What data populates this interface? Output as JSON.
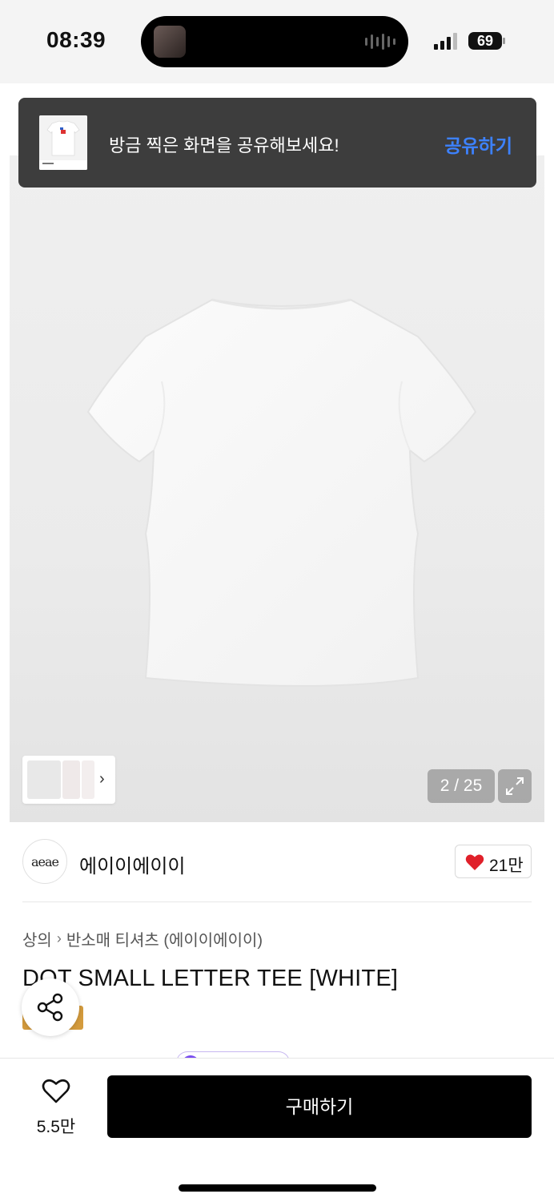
{
  "status_bar": {
    "time": "08:39",
    "battery": "69"
  },
  "share_banner": {
    "message": "방금 찍은 화면을 공유해보세요!",
    "action_label": "공유하기"
  },
  "gallery": {
    "counter": "2 / 25",
    "current_index": 2,
    "total": 25
  },
  "brand": {
    "logo_text": "aeae",
    "name": "에이이에이이",
    "like_count": "21만"
  },
  "breadcrumb": {
    "category": "상의",
    "subcategory": "반소매 티셔츠 (에이이에이이)"
  },
  "product": {
    "title": "DOT SMALL LETTER TEE [WHITE]"
  },
  "bottom_bar": {
    "wish_count": "5.5만",
    "buy_label": "구매하기"
  },
  "colors": {
    "accent_blue": "#3d82ff",
    "heart_red": "#e0202a",
    "gold_tag": "#d49b3d"
  }
}
